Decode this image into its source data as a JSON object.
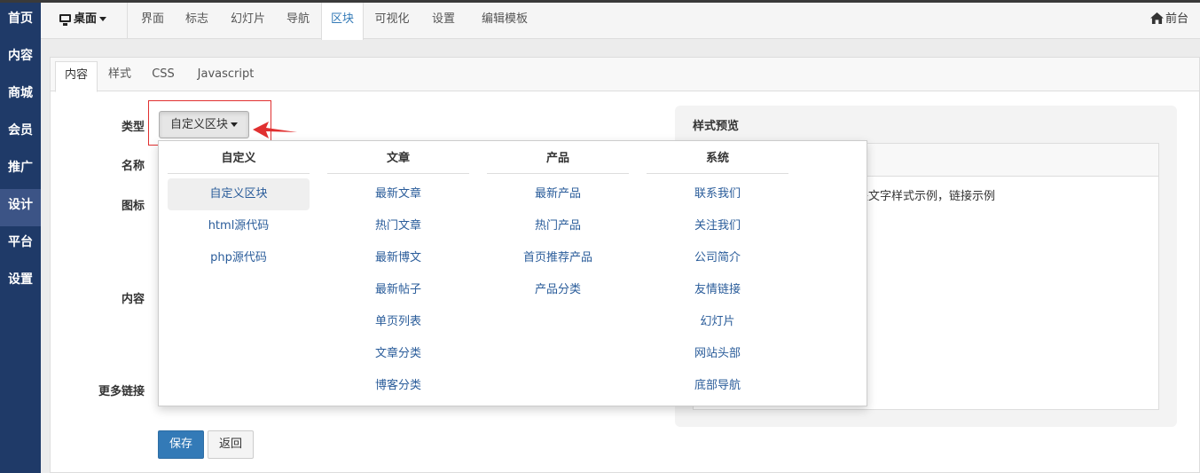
{
  "sidebar": {
    "items": [
      {
        "label": "首页"
      },
      {
        "label": "内容"
      },
      {
        "label": "商城"
      },
      {
        "label": "会员"
      },
      {
        "label": "推广"
      },
      {
        "label": "设计"
      },
      {
        "label": "平台"
      },
      {
        "label": "设置"
      }
    ],
    "active_index": 5
  },
  "topnav": {
    "device_label": "桌面",
    "tabs": [
      {
        "label": "界面"
      },
      {
        "label": "标志"
      },
      {
        "label": "幻灯片"
      },
      {
        "label": "导航"
      },
      {
        "label": "区块"
      },
      {
        "label": "可视化"
      },
      {
        "label": "设置"
      },
      {
        "label": "编辑模板"
      }
    ],
    "active_tab": "区块",
    "frontend_label": "前台"
  },
  "subtabs": {
    "tabs": [
      {
        "label": "内容"
      },
      {
        "label": "样式"
      },
      {
        "label": "CSS"
      },
      {
        "label": "Javascript"
      }
    ],
    "active_tab": "内容"
  },
  "form": {
    "type_label": "类型",
    "name_label": "名称",
    "icon_label": "图标",
    "content_label": "内容",
    "more_link_label": "更多链接",
    "type_value": "自定义区块",
    "save_label": "保存",
    "back_label": "返回"
  },
  "preview": {
    "title": "样式预览",
    "text": "块文字样式示例，链接示例"
  },
  "dropdown": {
    "columns": [
      {
        "header": "自定义",
        "items": [
          "自定义区块",
          "html源代码",
          "php源代码"
        ]
      },
      {
        "header": "文章",
        "items": [
          "最新文章",
          "热门文章",
          "最新博文",
          "最新帖子",
          "单页列表",
          "文章分类",
          "博客分类"
        ]
      },
      {
        "header": "产品",
        "items": [
          "最新产品",
          "热门产品",
          "首页推荐产品",
          "产品分类"
        ]
      },
      {
        "header": "系统",
        "items": [
          "联系我们",
          "关注我们",
          "公司简介",
          "友情链接",
          "幻灯片",
          "网站头部",
          "底部导航"
        ]
      }
    ],
    "selected": "自定义区块"
  },
  "colors": {
    "sidebar_bg": "#1f3a68",
    "sidebar_active": "#3c5486",
    "accent": "#337ab7",
    "highlight": "#e03030"
  },
  "icons": {
    "device": "monitor-icon",
    "frontend": "home-icon",
    "annotation": "red-arrow-icon"
  }
}
